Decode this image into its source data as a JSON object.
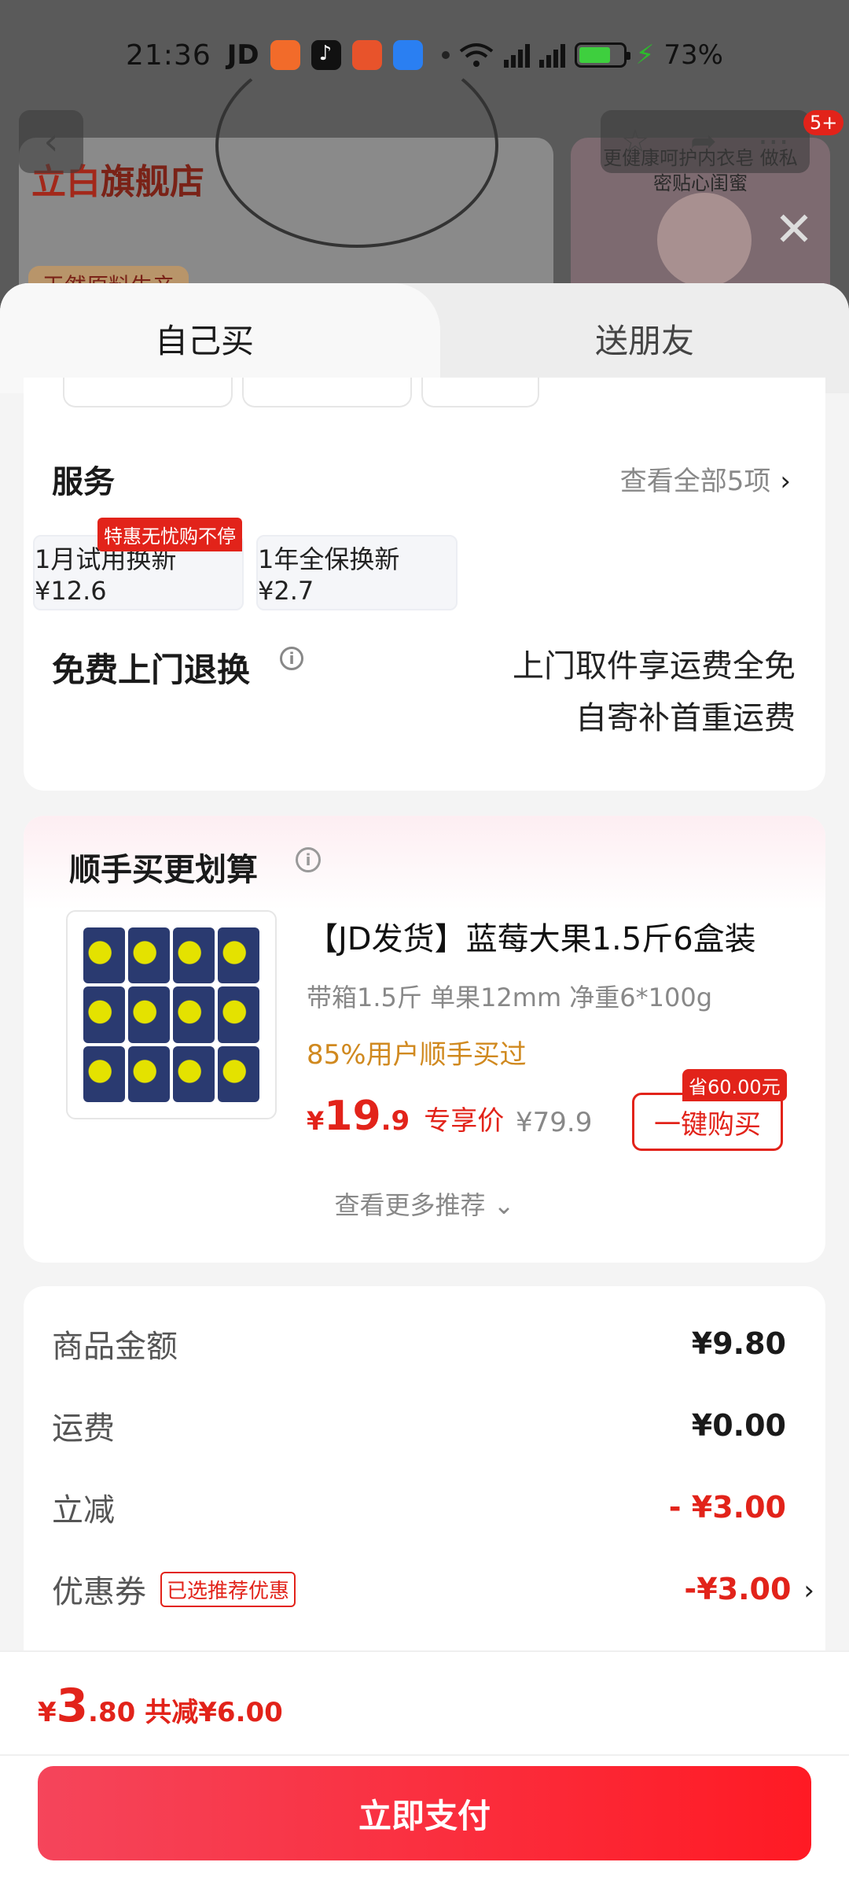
{
  "status_bar": {
    "time": "21:36",
    "carrier": "JD",
    "battery_pct": "73%",
    "battery_level": 0.73
  },
  "background": {
    "store_logo": "立白",
    "store_name": "旗舰店",
    "tag": "天然原料生产",
    "ad_text": "更健康呵护内衣皂 做私密贴心闺蜜",
    "badge_count": "5+"
  },
  "tabs": [
    {
      "label": "自己买",
      "active": true
    },
    {
      "label": "送朋友",
      "active": false
    }
  ],
  "service": {
    "title": "服务",
    "more": "查看全部5项",
    "chips": [
      {
        "label": "1月试用换新  ¥12.6",
        "tag": "特惠无忧购不停"
      },
      {
        "label": "1年全保换新  ¥2.7",
        "tag": ""
      }
    ]
  },
  "return": {
    "title": "免费上门退换",
    "line1": "上门取件享运费全免",
    "line2": "自寄补首重运费"
  },
  "bundle": {
    "title": "顺手买更划算",
    "product": {
      "name": "【JD发货】蓝莓大果1.5斤6盒装",
      "spec": "带箱1.5斤 单果12mm 净重6*100g",
      "popularity": "85%用户顺手买过",
      "price_yen": "¥",
      "price_int": "19",
      "price_dec": ".9",
      "price_label": "专享价",
      "original_price": "¥79.9",
      "save_tag": "省60.00元",
      "buy_label": "一键购买"
    },
    "more": "查看更多推荐 ⌄"
  },
  "summary": {
    "rows": [
      {
        "label": "商品金额",
        "value": "¥9.80"
      },
      {
        "label": "运费",
        "value": "¥0.00"
      },
      {
        "label": "立减",
        "value": "- ¥3.00"
      },
      {
        "label": "优惠券",
        "value": "-¥3.00",
        "tag": "已选推荐优惠"
      }
    ]
  },
  "bottom": {
    "total_yen": "¥",
    "total_int": "3",
    "total_dec": ".80",
    "total_off": "共减¥6.00",
    "pay_label": "立即支付"
  },
  "colors": {
    "accent_red": "#e2231a",
    "popularity_orange": "#d0891f",
    "pay_gradient_start": "#f5455b",
    "pay_gradient_end": "#ff1a24"
  },
  "icons": [
    "back-arrow-icon",
    "star-icon",
    "share-icon",
    "more-icon",
    "close-icon",
    "info-icon",
    "chevron-right-icon",
    "wifi-icon",
    "signal-icon",
    "battery-icon"
  ]
}
